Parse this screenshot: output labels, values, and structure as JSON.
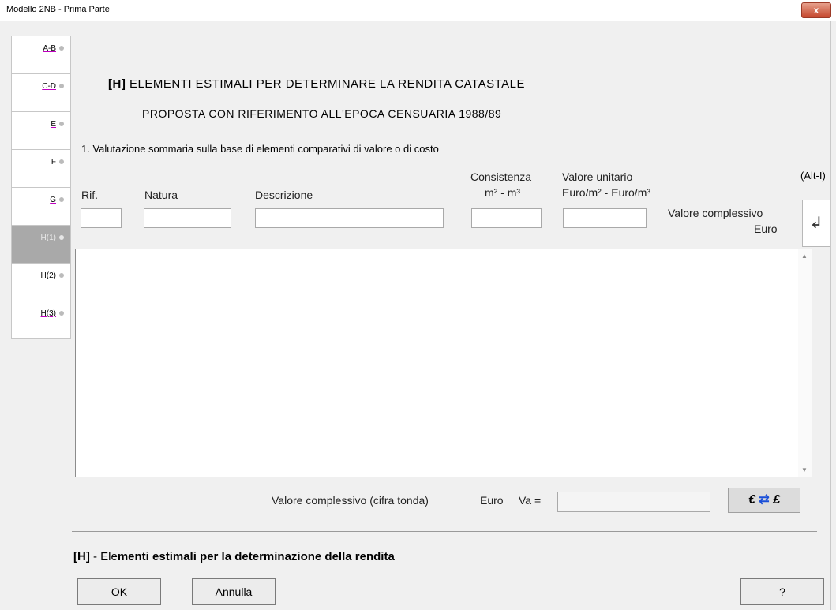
{
  "window": {
    "title": "Modello 2NB - Prima Parte",
    "close_label": "x"
  },
  "sidebar": {
    "items": [
      {
        "label": "A-B",
        "active": false
      },
      {
        "label": "C-D",
        "active": false
      },
      {
        "label": "E",
        "active": false
      },
      {
        "label": "F",
        "active": false
      },
      {
        "label": "G",
        "active": false
      },
      {
        "label": "H(1)",
        "active": true
      },
      {
        "label": "H(2)",
        "active": false
      },
      {
        "label": "H(3)",
        "active": false
      }
    ]
  },
  "header": {
    "tag": "[H]",
    "title": "ELEMENTI ESTIMALI PER DETERMINARE LA RENDITA CATASTALE",
    "subtitle": "PROPOSTA CON RIFERIMENTO ALL'EPOCA CENSUARIA 1988/89"
  },
  "section": {
    "label": "1. Valutazione sommaria sulla base di elementi comparativi di valore o di costo"
  },
  "columns": {
    "rif": "Rif.",
    "natura": "Natura",
    "descrizione": "Descrizione",
    "consistenza": "Consistenza",
    "consistenza_unit": "m² - m³",
    "valore_unitario": "Valore unitario",
    "valore_unitario_unit": "Euro/m² - Euro/m³",
    "valore_complessivo": "Valore complessivo",
    "valore_complessivo_unit": "Euro",
    "alt_hint": "(Alt-I)"
  },
  "fields": {
    "rif": "",
    "natura": "",
    "descrizione": "",
    "consistenza": "",
    "valore_unitario": "",
    "va": ""
  },
  "summary": {
    "label": "Valore complessivo (cifra tonda)",
    "currency": "Euro",
    "va_label": "Va ="
  },
  "currency_button": {
    "label_left": "€",
    "label_right": "£"
  },
  "footer": {
    "tag": "[H]",
    "dash": "- Ele",
    "title_bold": "menti estimali per la determinazione della rendita",
    "ok_label": "OK",
    "cancel_label": "Annulla",
    "help_label": "?"
  }
}
